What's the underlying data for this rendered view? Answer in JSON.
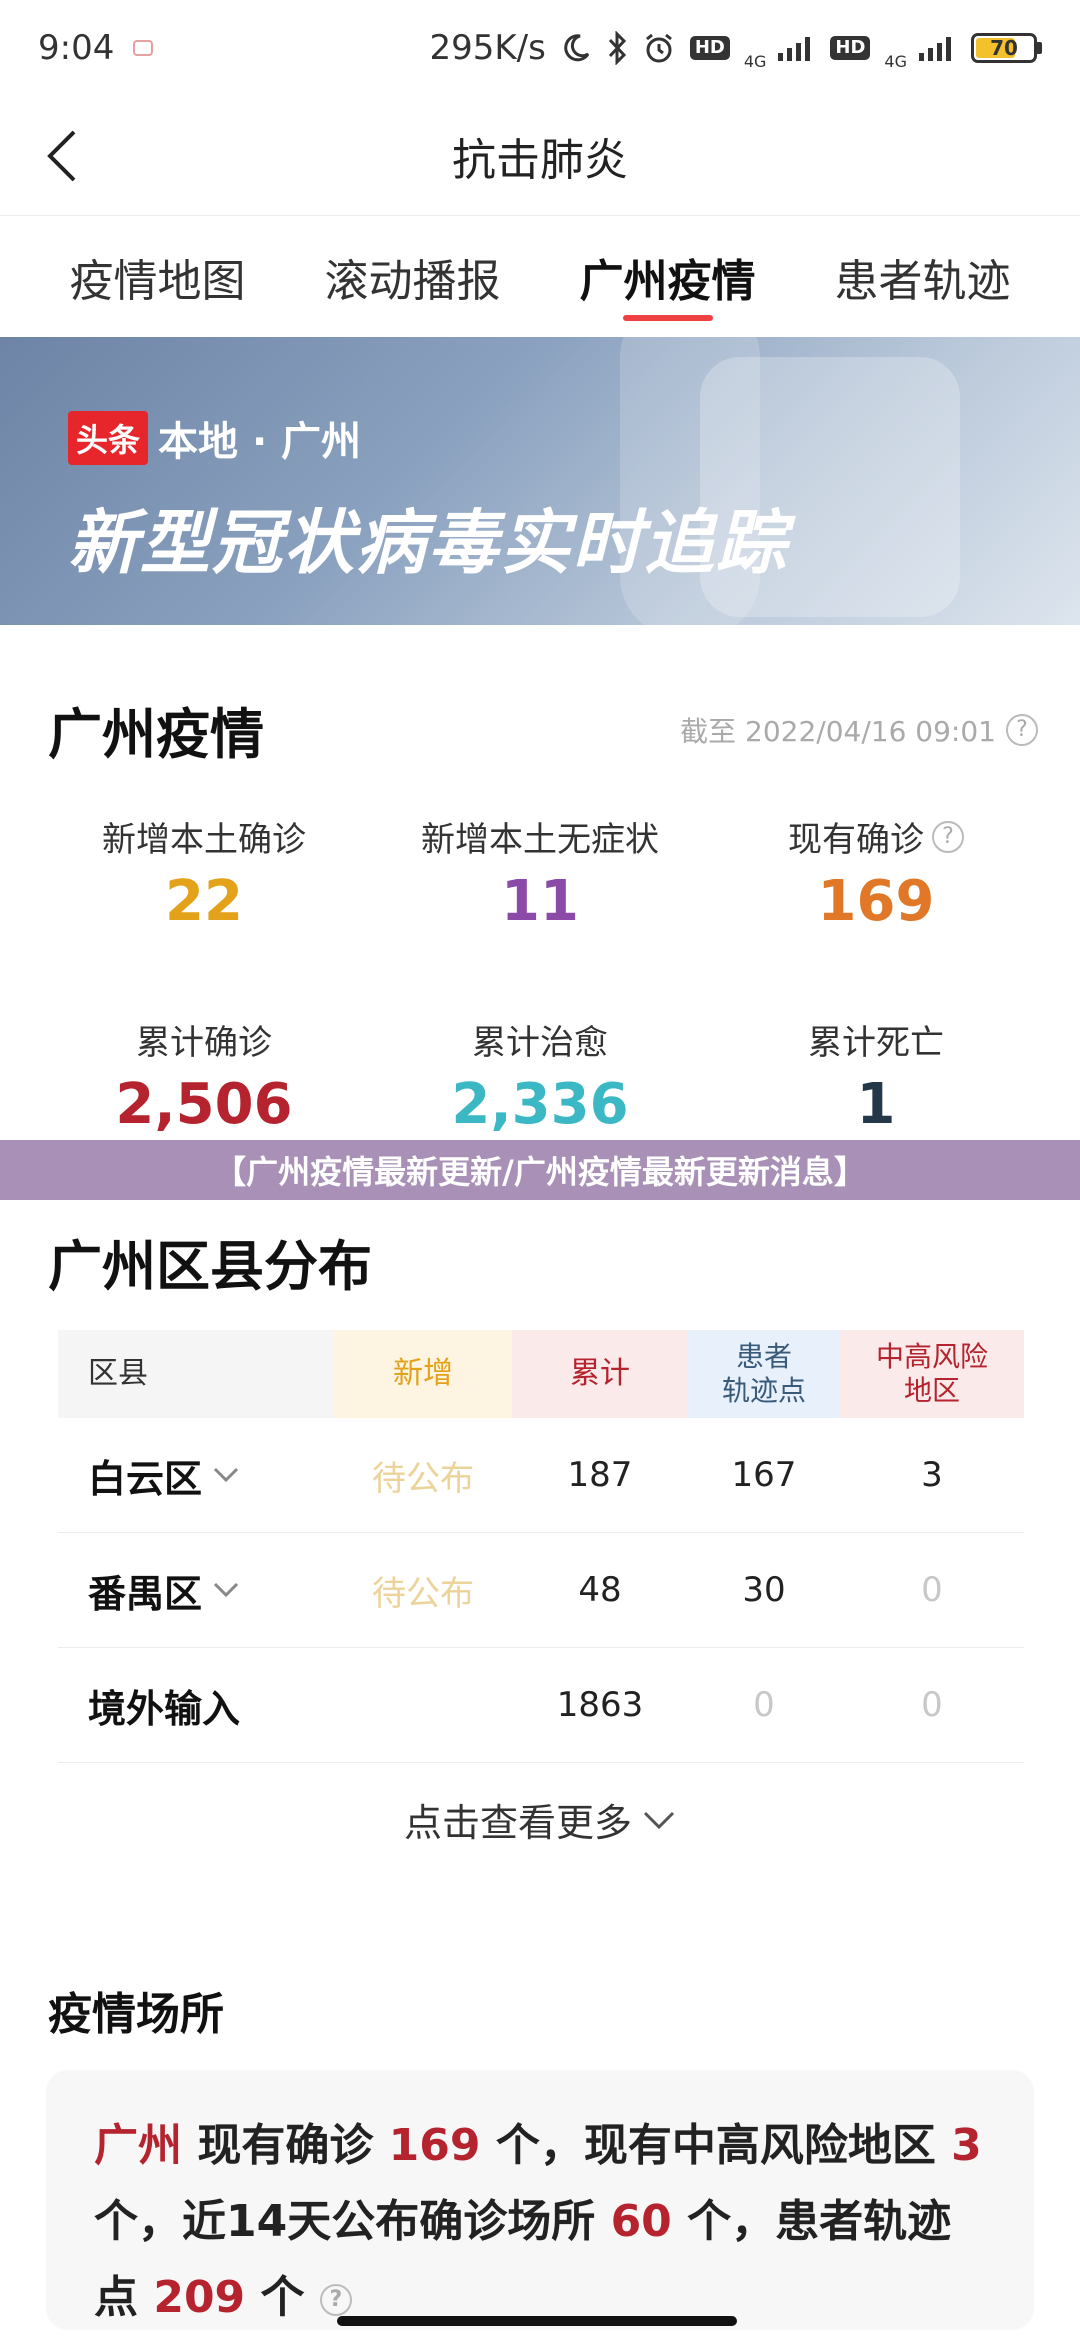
{
  "status_bar": {
    "time": "9:04",
    "net_speed": "295K/s",
    "net1": "4G",
    "net2": "4G",
    "hd": "HD",
    "battery": 70
  },
  "header": {
    "title": "抗击肺炎"
  },
  "tabs": [
    {
      "label": "疫情地图",
      "active": false
    },
    {
      "label": "滚动播报",
      "active": false
    },
    {
      "label": "广州疫情",
      "active": true
    },
    {
      "label": "患者轨迹",
      "active": false
    }
  ],
  "banner": {
    "tag": "头条",
    "subtitle": "本地 · 广州",
    "title": "新型冠状病毒实时追踪"
  },
  "summary": {
    "title": "广州疫情",
    "update": "截至 2022/04/16 09:01",
    "row1": [
      {
        "label": "新增本土确诊",
        "value": "22",
        "color": "#e3a21a"
      },
      {
        "label": "新增本土无症状",
        "value": "11",
        "color": "#8b4aa8"
      },
      {
        "label": "现有确诊",
        "value": "169",
        "color": "#e07828"
      }
    ],
    "row2": [
      {
        "label": "累计确诊",
        "value": "2,506",
        "color": "#b5232e"
      },
      {
        "label": "累计治愈",
        "value": "2,336",
        "color": "#3bb8c4"
      },
      {
        "label": "累计死亡",
        "value": "1",
        "color": "#24384a"
      }
    ]
  },
  "caption": "【广州疫情最新更新/广州疫情最新更新消息】",
  "district": {
    "title": "广州区县分布",
    "headers": [
      "区县",
      "新增",
      "累计",
      "患者\n轨迹点",
      "中高风险\n地区"
    ],
    "rows": [
      {
        "name": "白云区",
        "new": "待公布",
        "total": "187",
        "points": "167",
        "risk": "3",
        "expandable": true
      },
      {
        "name": "番禺区",
        "new": "待公布",
        "total": "48",
        "points": "30",
        "risk": "0",
        "expandable": true
      },
      {
        "name": "境外输入",
        "new": "",
        "total": "1863",
        "points": "0",
        "risk": "0",
        "expandable": false
      }
    ],
    "more": "点击查看更多"
  },
  "venue": {
    "title": "疫情场所",
    "city": "广州",
    "t1": " 现有确诊 ",
    "n1": "169",
    "t2": " 个，现有中高风险地区 ",
    "n2": "3",
    "t3": " 个，近14天公布确诊场所 ",
    "n3": "60",
    "t4": " 个，患者轨迹点 ",
    "n4": "209",
    "t5": " 个 "
  }
}
